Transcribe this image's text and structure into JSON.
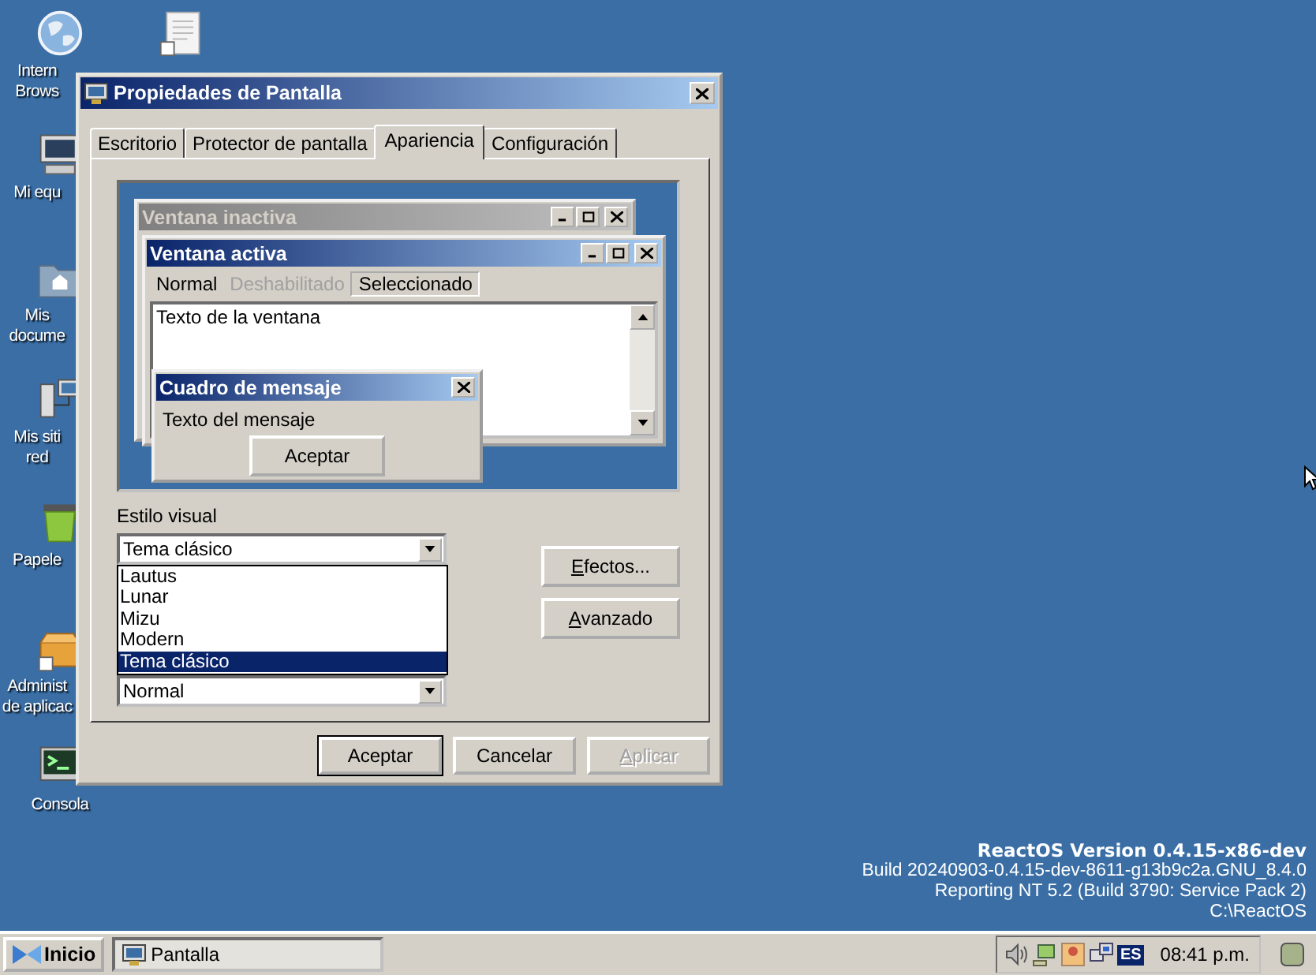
{
  "desktop_icons": [
    {
      "kind": "globe",
      "lines": [
        "Intern",
        "Brows"
      ]
    },
    {
      "kind": "document"
    },
    {
      "kind": "computer",
      "lines": [
        "Mi equ"
      ]
    },
    {
      "kind": "folder",
      "lines": [
        "Mis",
        "docume"
      ]
    },
    {
      "kind": "network",
      "lines": [
        "Mis siti",
        "red"
      ]
    },
    {
      "kind": "recycle",
      "lines": [
        "Papele"
      ]
    },
    {
      "kind": "package",
      "lines": [
        "Administ",
        "de aplicac"
      ]
    },
    {
      "kind": "console",
      "lines": [
        "Consola"
      ]
    }
  ],
  "dialog": {
    "title": "Propiedades de Pantalla",
    "tabs": [
      {
        "label": "Escritorio",
        "selected": false
      },
      {
        "label": "Protector de pantalla",
        "selected": false
      },
      {
        "label": "Apariencia",
        "selected": true
      },
      {
        "label": "Configuración",
        "selected": false
      }
    ],
    "preview": {
      "inactive_title": "Ventana inactiva",
      "active_title": "Ventana activa",
      "menu": [
        {
          "label": "Normal",
          "kind": "normal"
        },
        {
          "label": "Deshabilitado",
          "kind": "disabled"
        },
        {
          "label": "Seleccionado",
          "kind": "selected"
        }
      ],
      "window_text": "Texto de la ventana",
      "message_title": "Cuadro de mensaje",
      "message_text": "Texto del mensaje",
      "message_button": "Aceptar"
    },
    "visual_style": {
      "label": "Estilo visual",
      "value": "Tema clásico",
      "options": [
        {
          "label": "Lautus",
          "selected": false
        },
        {
          "label": "Lunar",
          "selected": false
        },
        {
          "label": "Mizu",
          "selected": false
        },
        {
          "label": "Modern",
          "selected": false
        },
        {
          "label": "Tema clásico",
          "selected": true
        }
      ]
    },
    "second_combo": {
      "value": "Normal"
    },
    "side_buttons": [
      {
        "key": "E",
        "rest": "fectos..."
      },
      {
        "key": "A",
        "rest": "vanzado"
      }
    ],
    "buttons": [
      {
        "rest": "Aceptar",
        "default": true,
        "disabled": false
      },
      {
        "rest": "Cancelar",
        "default": false,
        "disabled": false
      },
      {
        "key": "A",
        "rest": "plicar",
        "default": false,
        "disabled": true
      }
    ]
  },
  "version_info": [
    "ReactOS Version 0.4.15-x86-dev",
    "Build 20240903-0.4.15-dev-8611-g13b9c2a.GNU_8.4.0",
    "Reporting NT 5.2 (Build 3790: Service Pack 2)",
    "C:\\ReactOS"
  ],
  "taskbar": {
    "start": "Inicio",
    "tasks": [
      {
        "label": "Pantalla",
        "selected": true
      }
    ],
    "language": "ES",
    "clock": "08:41 p.m."
  }
}
